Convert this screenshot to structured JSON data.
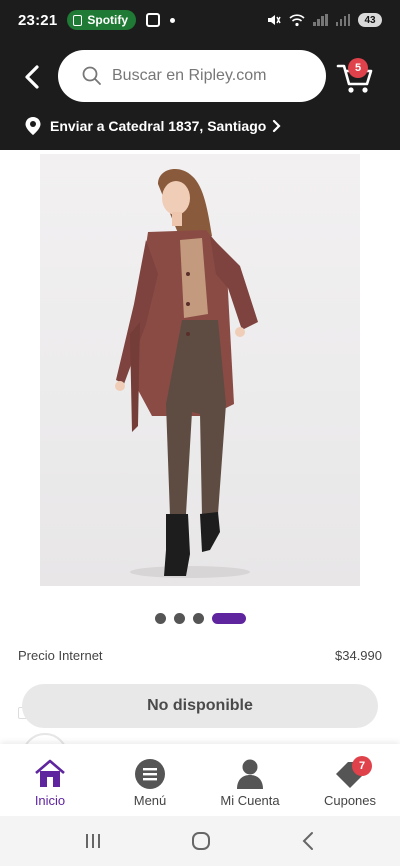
{
  "status_bar": {
    "time": "23:21",
    "spotify_label": "Spotify",
    "battery": "43"
  },
  "header": {
    "search_placeholder": "Buscar en Ripley.com",
    "cart_count": "5",
    "location_prefix": "Enviar a",
    "location_text": "Enviar a Catedral  1837, Santiago"
  },
  "product": {
    "image_icon": "product-photo",
    "carousel": {
      "total": 4,
      "active_index": 3
    },
    "price_label": "Precio Internet",
    "price_value": "$34.990",
    "availability_button": "No disponible"
  },
  "bottom_nav": {
    "items": [
      {
        "label": "Inicio",
        "icon": "home-icon",
        "active": true
      },
      {
        "label": "Menú",
        "icon": "menu-icon",
        "active": false
      },
      {
        "label": "Mi Cuenta",
        "icon": "user-icon",
        "active": false
      },
      {
        "label": "Cupones",
        "icon": "coupon-icon",
        "active": false,
        "badge": "7"
      }
    ]
  },
  "colors": {
    "header_bg": "#1c1c1c",
    "accent_purple": "#5f259f",
    "badge_red": "#e0424b",
    "spotify_green": "#1f7a35"
  }
}
